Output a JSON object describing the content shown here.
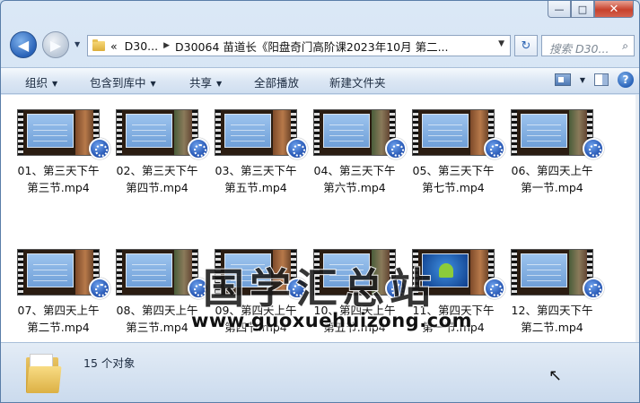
{
  "window": {
    "caption": {
      "minimize": "—",
      "maximize": "□",
      "close": "✕"
    }
  },
  "nav": {
    "back": "◀",
    "forward": "▶",
    "dropdown": "▼"
  },
  "address": {
    "chevron": "«",
    "crumbs": [
      "D30...",
      "D30064 苗道长《阳盘奇门高阶课2023年10月 第二..."
    ],
    "separator": "▶",
    "dropdown": "▼",
    "refresh": "↻"
  },
  "search": {
    "placeholder": "搜索 D30...",
    "icon": "search-icon",
    "glyph": "⌕"
  },
  "commands": [
    {
      "label": "组织",
      "has_arrow": true
    },
    {
      "label": "包含到库中",
      "has_arrow": true
    },
    {
      "label": "共享",
      "has_arrow": true
    },
    {
      "label": "全部播放",
      "has_arrow": false
    },
    {
      "label": "新建文件夹",
      "has_arrow": false
    }
  ],
  "command_arrow": "▼",
  "help_glyph": "?",
  "files": [
    {
      "line1": "01、第三天下午",
      "line2": "第三节.mp4",
      "thumb": "board"
    },
    {
      "line1": "02、第三天下午",
      "line2": "第四节.mp4",
      "thumb": "board"
    },
    {
      "line1": "03、第三天下午",
      "line2": "第五节.mp4",
      "thumb": "board"
    },
    {
      "line1": "04、第三天下午",
      "line2": "第六节.mp4",
      "thumb": "board"
    },
    {
      "line1": "05、第三天下午",
      "line2": "第七节.mp4",
      "thumb": "board"
    },
    {
      "line1": "06、第四天上午",
      "line2": "第一节.mp4",
      "thumb": "teacher"
    },
    {
      "line1": "07、第四天上午",
      "line2": "第二节.mp4",
      "thumb": "board"
    },
    {
      "line1": "08、第四天上午",
      "line2": "第三节.mp4",
      "thumb": "board"
    },
    {
      "line1": "09、第四天上午",
      "line2": "第四节.mp4",
      "thumb": "board"
    },
    {
      "line1": "10、第四天上午",
      "line2": "第五节.mp4",
      "thumb": "board"
    },
    {
      "line1": "11、第四天下午",
      "line2": "第一节.mp4",
      "thumb": "android"
    },
    {
      "line1": "12、第四天下午",
      "line2": "第二节.mp4",
      "thumb": "board"
    }
  ],
  "watermark": {
    "title": "国学汇总站",
    "url": "www.guoxuehuizong.com"
  },
  "status": {
    "count": "15 个对象"
  },
  "cursor_glyph": "↖"
}
